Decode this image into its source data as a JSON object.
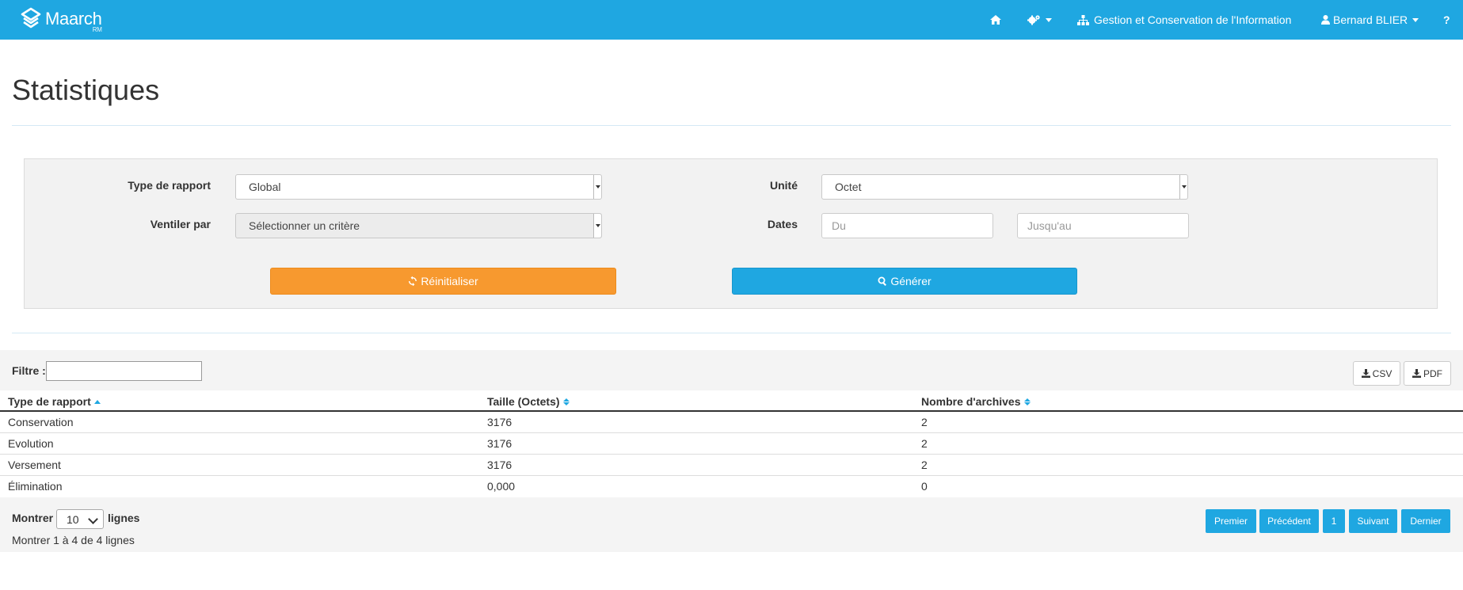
{
  "navbar": {
    "brand": "Maarch",
    "brand_sub": "RM",
    "org_label": "Gestion et Conservation de l'Information",
    "user_label": "Bernard BLIER",
    "help_label": "?"
  },
  "page": {
    "title": "Statistiques"
  },
  "form": {
    "report_type_label": "Type de rapport",
    "report_type_value": "Global",
    "unit_label": "Unité",
    "unit_value": "Octet",
    "breakdown_label": "Ventiler par",
    "breakdown_value": "Sélectionner un critère",
    "dates_label": "Dates",
    "date_from_placeholder": "Du",
    "date_to_placeholder": "Jusqu'au",
    "reset_label": "Réinitialiser",
    "generate_label": "Générer"
  },
  "table": {
    "filter_label": "Filtre :",
    "csv_label": "CSV",
    "pdf_label": "PDF",
    "columns": [
      "Type de rapport",
      "Taille (Octets)",
      "Nombre d'archives"
    ],
    "rows": [
      [
        "Conservation",
        "3176",
        "2"
      ],
      [
        "Evolution",
        "3176",
        "2"
      ],
      [
        "Versement",
        "3176",
        "2"
      ],
      [
        "Élimination",
        "0,000",
        "0"
      ]
    ],
    "show_label": "Montrer",
    "page_length": "10",
    "lines_label": "lignes",
    "info": "Montrer 1 à 4 de 4 lignes"
  },
  "pagination": {
    "first": "Premier",
    "previous": "Précédent",
    "current": "1",
    "next": "Suivant",
    "last": "Dernier"
  },
  "colors": {
    "primary": "#1fa7e1",
    "warning": "#f7992f"
  }
}
